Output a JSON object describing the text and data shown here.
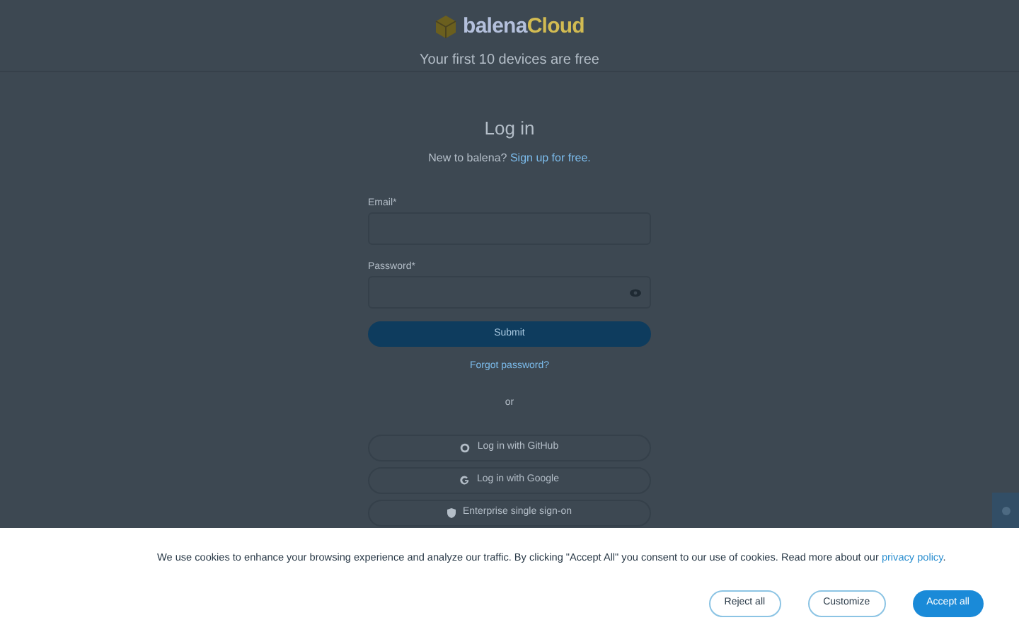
{
  "header": {
    "logo": {
      "brand": "balena",
      "product": "Cloud"
    },
    "tagline": "Your first 10 devices are free"
  },
  "login": {
    "title": "Log in",
    "signup_prompt": "New to balena?",
    "signup_link": "Sign up for free.",
    "fields": [
      {
        "label": "Email",
        "required_mark": "*",
        "kind": "text"
      },
      {
        "label": "Password",
        "required_mark": "*",
        "kind": "password"
      }
    ],
    "submit": "Submit",
    "forgot": "Forgot password?",
    "divider": "or",
    "providers": [
      {
        "label": "Log in with GitHub",
        "kind": "github"
      },
      {
        "label": "Log in with Google",
        "kind": "google"
      },
      {
        "label": "Enterprise single sign-on",
        "kind": "sso"
      }
    ]
  },
  "cookie_banner": {
    "message": "We use cookies to enhance your browsing experience and analyze our traffic. By clicking \"Accept All\" you consent to our use of cookies. Read more about our",
    "link": "privacy policy",
    "after_link": ".",
    "buttons": [
      {
        "label": "Reject all",
        "kind": "outline"
      },
      {
        "label": "Customize",
        "kind": "outline"
      },
      {
        "label": "Accept all",
        "kind": "primary"
      }
    ]
  }
}
